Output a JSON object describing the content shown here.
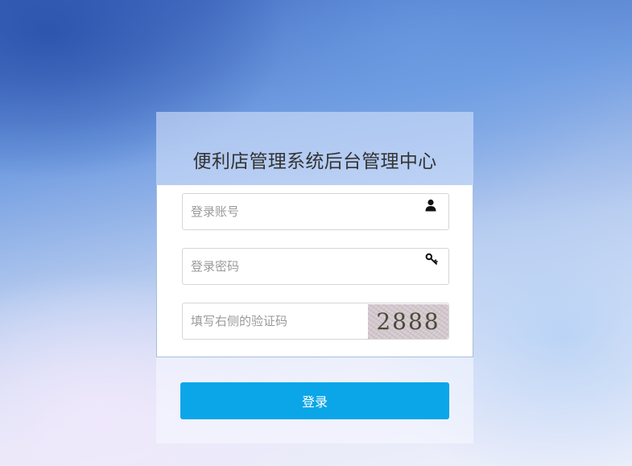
{
  "title": "便利店管理系统后台管理中心",
  "account": {
    "placeholder": "登录账号",
    "value": "",
    "icon": "user-icon"
  },
  "password": {
    "placeholder": "登录密码",
    "value": "",
    "icon": "key-icon"
  },
  "captcha": {
    "placeholder": "填写右侧的验证码",
    "value": "",
    "code": "2888"
  },
  "login_label": "登录",
  "colors": {
    "button": "#0aa6e8",
    "title": "#333333"
  }
}
